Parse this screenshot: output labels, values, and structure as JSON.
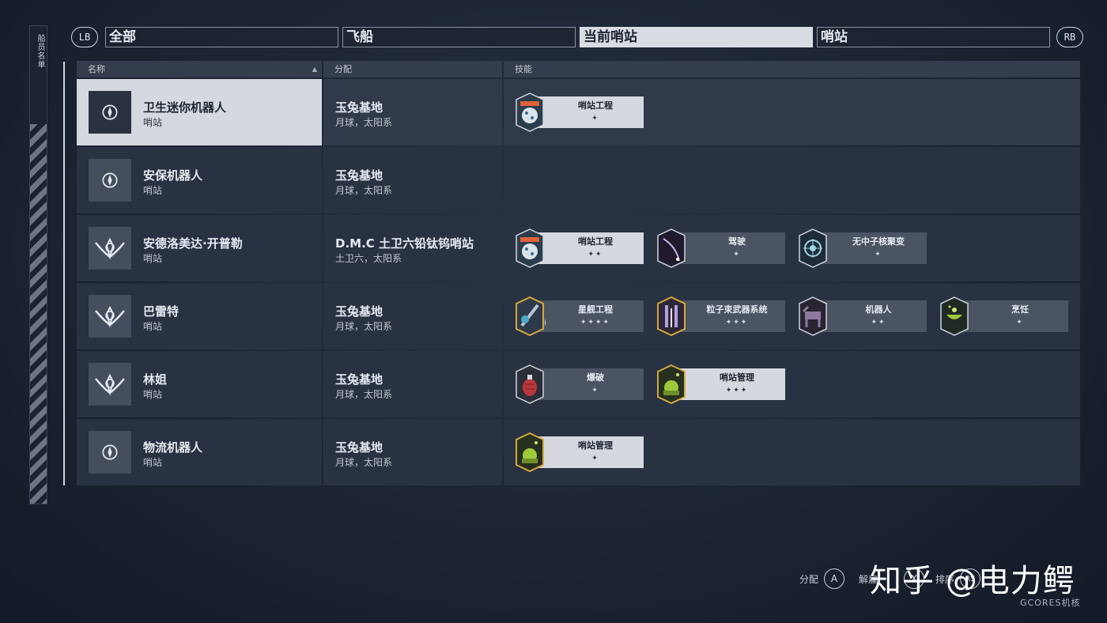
{
  "side_rail": {
    "label": "船员名单"
  },
  "tabs": {
    "left_bumper": "LB",
    "right_bumper": "RB",
    "items": [
      {
        "label": "全部",
        "active": false
      },
      {
        "label": "飞船",
        "active": false
      },
      {
        "label": "当前哨站",
        "active": true
      },
      {
        "label": "哨站",
        "active": false
      }
    ]
  },
  "table": {
    "headers": {
      "name": "名称",
      "assignment": "分配",
      "skills": "技能",
      "sort_indicator": "▲"
    },
    "rows": [
      {
        "name": "卫生迷你机器人",
        "role": "哨站",
        "location": "玉兔基地",
        "system": "月球，太阳系",
        "selected": true,
        "avatar_icon": "robot-compass-icon",
        "skills": [
          {
            "name": "哨站工程",
            "rank": "✦",
            "emblem": "outpost-engineering-icon",
            "highlight": true
          }
        ]
      },
      {
        "name": "安保机器人",
        "role": "哨站",
        "location": "玉兔基地",
        "system": "月球，太阳系",
        "selected": false,
        "avatar_icon": "robot-compass-icon",
        "skills": []
      },
      {
        "name": "安德洛美达·开普勒",
        "role": "哨站",
        "location": "D.M.C 土卫六铅钛钨哨站",
        "system": "土卫六，太阳系",
        "selected": false,
        "avatar_icon": "constellation-wing-icon",
        "skills": [
          {
            "name": "哨站工程",
            "rank": "✦✦",
            "emblem": "outpost-engineering-icon",
            "highlight": true
          },
          {
            "name": "驾驶",
            "rank": "✦",
            "emblem": "piloting-icon",
            "highlight": false
          },
          {
            "name": "无中子核聚变",
            "rank": "✦",
            "emblem": "aneutronic-fusion-icon",
            "highlight": false
          }
        ]
      },
      {
        "name": "巴雷特",
        "role": "哨站",
        "location": "玉兔基地",
        "system": "月球，太阳系",
        "selected": false,
        "avatar_icon": "constellation-wing-icon",
        "skills": [
          {
            "name": "星舰工程",
            "rank": "✦✦✦✦",
            "emblem": "starship-engineering-icon",
            "highlight": false
          },
          {
            "name": "粒子束武器系统",
            "rank": "✦✦✦",
            "emblem": "particle-beam-icon",
            "highlight": false
          },
          {
            "name": "机器人",
            "rank": "✦✦",
            "emblem": "robotics-icon",
            "highlight": false
          },
          {
            "name": "烹饪",
            "rank": "✦",
            "emblem": "gastronomy-icon",
            "highlight": false
          }
        ]
      },
      {
        "name": "林姐",
        "role": "哨站",
        "location": "玉兔基地",
        "system": "月球，太阳系",
        "selected": false,
        "avatar_icon": "constellation-wing-icon",
        "skills": [
          {
            "name": "爆破",
            "rank": "✦",
            "emblem": "demolitions-icon",
            "highlight": false
          },
          {
            "name": "哨站管理",
            "rank": "✦✦✦",
            "emblem": "outpost-management-icon",
            "highlight": true
          }
        ]
      },
      {
        "name": "物流机器人",
        "role": "哨站",
        "location": "玉兔基地",
        "system": "月球，太阳系",
        "selected": false,
        "avatar_icon": "robot-compass-icon",
        "skills": [
          {
            "name": "哨站管理",
            "rank": "✦",
            "emblem": "outpost-management-icon",
            "highlight": true
          }
        ]
      }
    ]
  },
  "prompts": {
    "assign_label": "分配",
    "assign_button": "A",
    "unassign_label": "解雇",
    "unassign_button": "X",
    "sort_label": "排序",
    "sort_button": "RS"
  },
  "watermark": {
    "text": "知乎 @电力鳄",
    "source": "GCORES机核"
  },
  "colors": {
    "background": "#1c2433",
    "row": "#293243",
    "selected_row": "#d5d9df",
    "header": "#343d4d",
    "skill_plate": "#4b5463",
    "skill_plate_highlight": "#d5d9df",
    "text": "#e6eaf0"
  }
}
